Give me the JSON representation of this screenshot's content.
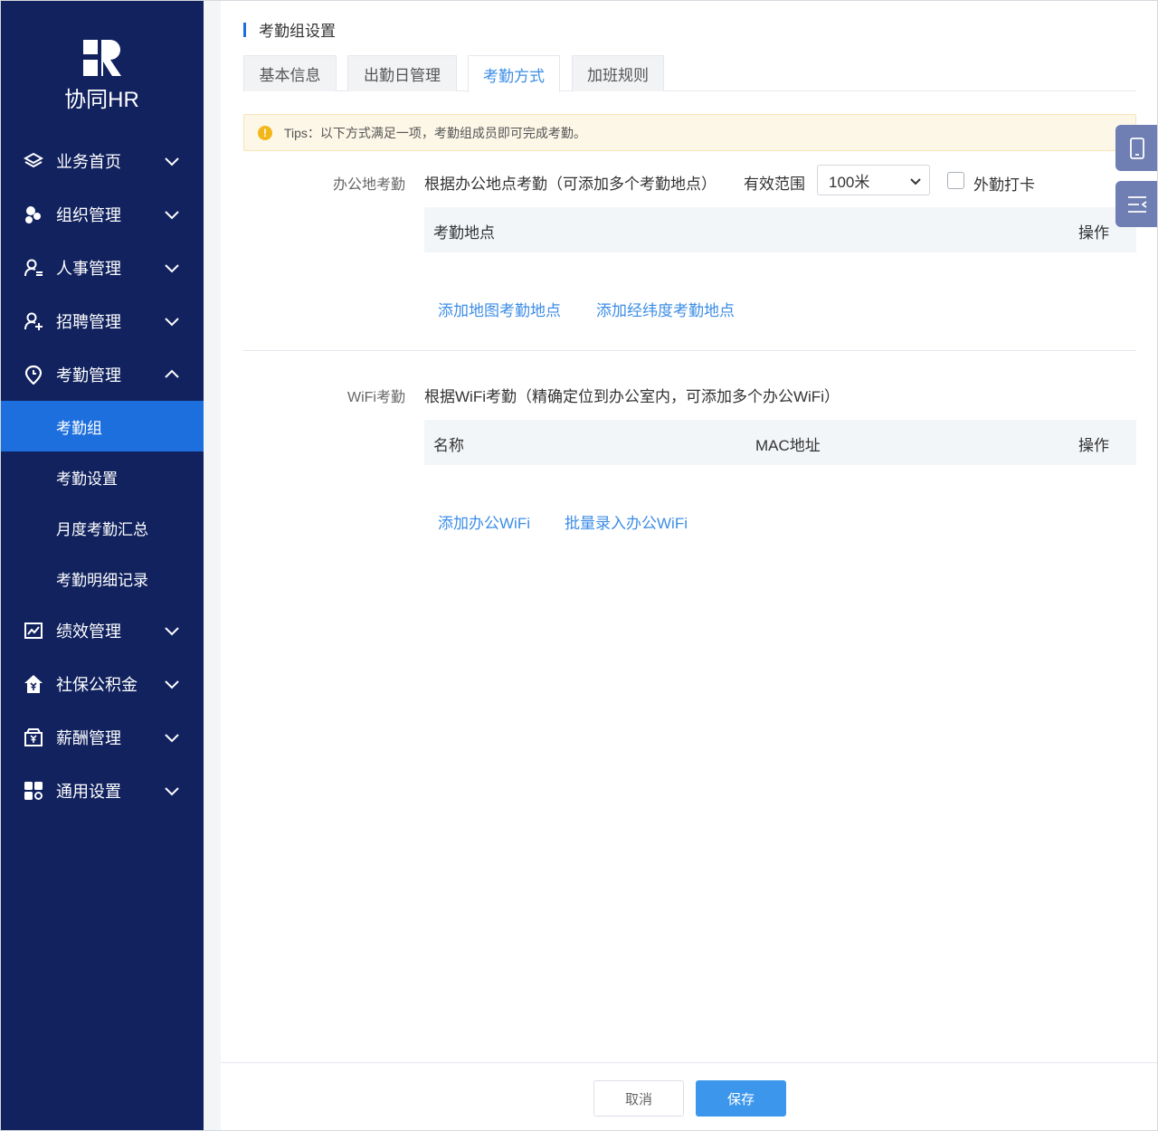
{
  "app": {
    "logo_text": "协同HR"
  },
  "sidebar": {
    "items": [
      {
        "label": "业务首页",
        "icon": "layers-icon"
      },
      {
        "label": "组织管理",
        "icon": "org-icon"
      },
      {
        "label": "人事管理",
        "icon": "person-list-icon"
      },
      {
        "label": "招聘管理",
        "icon": "person-add-icon"
      },
      {
        "label": "考勤管理",
        "icon": "location-clock-icon",
        "expanded": true
      },
      {
        "label": "绩效管理",
        "icon": "chart-icon"
      },
      {
        "label": "社保公积金",
        "icon": "house-yen-icon"
      },
      {
        "label": "薪酬管理",
        "icon": "wallet-yen-icon"
      },
      {
        "label": "通用设置",
        "icon": "grid-settings-icon"
      }
    ],
    "sub_items": [
      {
        "label": "考勤组",
        "active": true
      },
      {
        "label": "考勤设置"
      },
      {
        "label": "月度考勤汇总"
      },
      {
        "label": "考勤明细记录"
      }
    ]
  },
  "page": {
    "title": "考勤组设置"
  },
  "tabs": [
    {
      "label": "基本信息"
    },
    {
      "label": "出勤日管理"
    },
    {
      "label": "考勤方式",
      "active": true
    },
    {
      "label": "加班规则"
    }
  ],
  "tips": {
    "text": "Tips：以下方式满足一项，考勤组成员即可完成考勤。"
  },
  "office": {
    "label": "办公地考勤",
    "description": "根据办公地点考勤（可添加多个考勤地点）",
    "range_label": "有效范围",
    "range_value": "100米",
    "outside_label": "外勤打卡",
    "table_headers": {
      "place": "考勤地点",
      "action": "操作"
    },
    "add_map_link": "添加地图考勤地点",
    "add_latlng_link": "添加经纬度考勤地点"
  },
  "wifi": {
    "label": "WiFi考勤",
    "description": "根据WiFi考勤（精确定位到办公室内，可添加多个办公WiFi）",
    "table_headers": {
      "name": "名称",
      "mac": "MAC地址",
      "action": "操作"
    },
    "add_link": "添加办公WiFi",
    "batch_link": "批量录入办公WiFi"
  },
  "footer": {
    "cancel_label": "取消",
    "save_label": "保存"
  },
  "colors": {
    "sidebar_bg": "#11225e",
    "active": "#1d6fde",
    "link": "#3c8de6",
    "save": "#3c97ec"
  }
}
